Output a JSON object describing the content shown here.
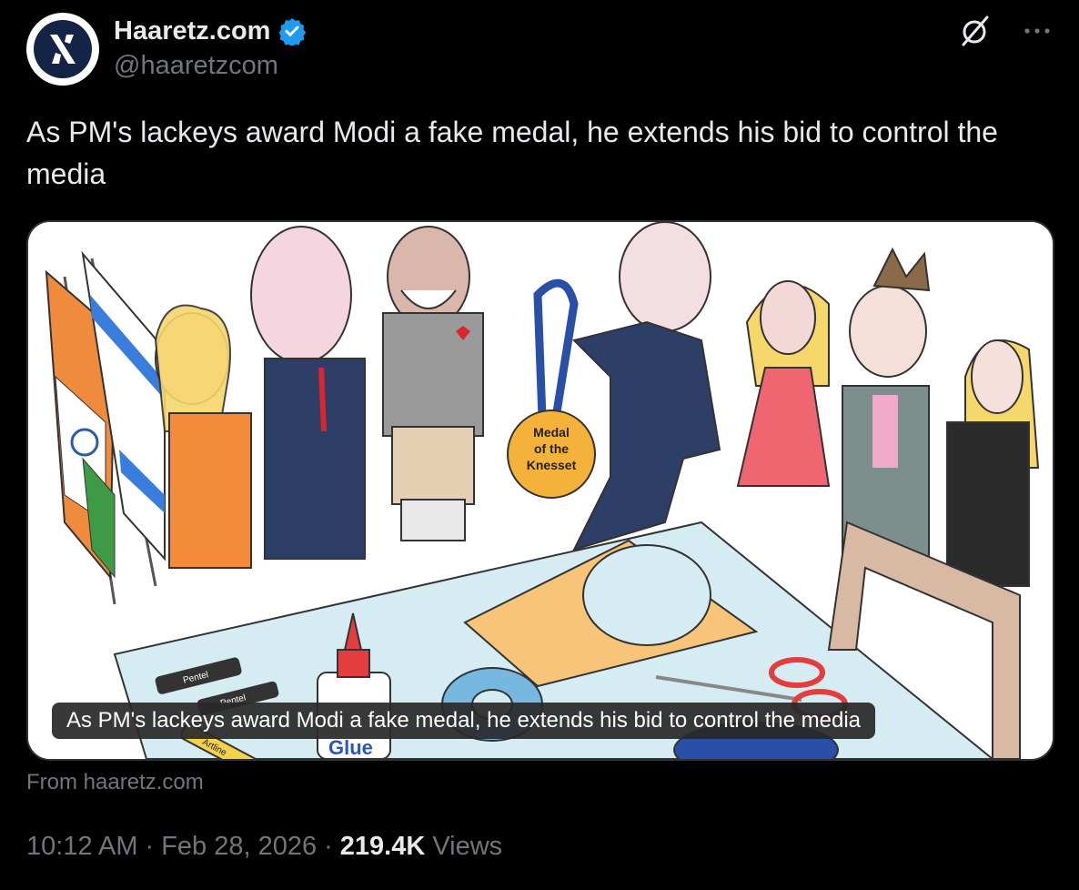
{
  "author": {
    "display_name": "Haaretz.com",
    "handle": "@haaretzcom",
    "verified": true,
    "avatar_letter": "ℵ"
  },
  "tweet": {
    "text": "As PM's lackeys award Modi a fake medal, he extends his bid to control the media"
  },
  "media": {
    "caption": "As PM's lackeys award Modi a fake medal, he extends his bid to control the media",
    "medal_text_1": "Medal",
    "medal_text_2": "of the",
    "medal_text_3": "Knesset",
    "marker_1": "Pentel",
    "marker_2": "Pentel",
    "glue_label": "Glue",
    "artline_label": "Artline"
  },
  "source": {
    "label": "From haaretz.com"
  },
  "meta": {
    "time": "10:12 AM",
    "separator_1": "·",
    "date": "Feb 28, 2026",
    "separator_2": "·",
    "views_count": "219.4K",
    "views_label": "Views"
  },
  "colors": {
    "background": "#000000",
    "text_primary": "#e7e9ea",
    "text_secondary": "#71767b",
    "verified_blue": "#1d9bf0",
    "avatar_navy": "#142447"
  },
  "icons": {
    "grok": "grok-slash-icon",
    "more": "more-dots-icon",
    "verified": "verified-badge-icon"
  }
}
